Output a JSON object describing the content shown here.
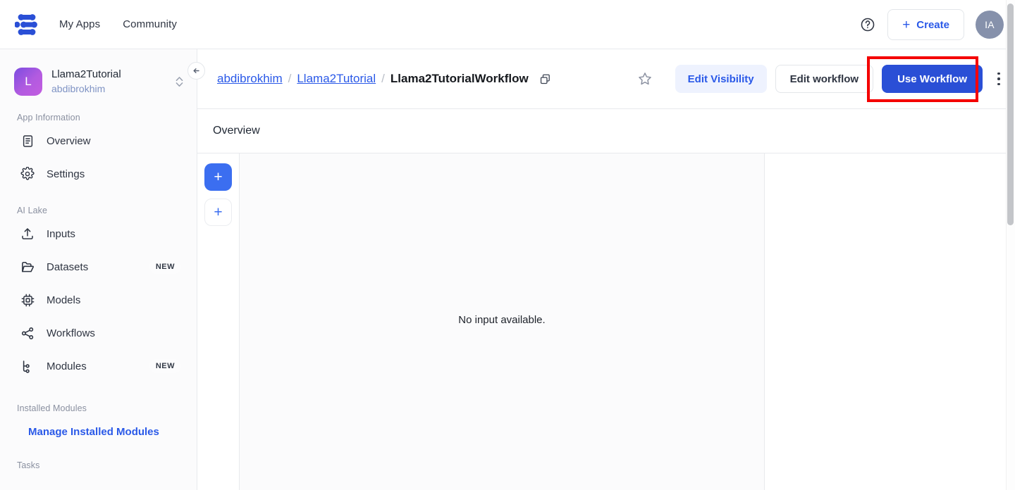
{
  "topnav": {
    "logo_name": "clarifai-logo",
    "links": [
      {
        "label": "My Apps",
        "name": "nav-my-apps"
      },
      {
        "label": "Community",
        "name": "nav-community"
      }
    ],
    "help_icon": "help-circle-icon",
    "create_label": "Create",
    "create_plus": "+",
    "avatar_initials": "IA"
  },
  "sidebar": {
    "app_avatar_letter": "L",
    "app_name": "Llama2Tutorial",
    "app_owner": "abdibrokhim",
    "switcher_icon": "chevron-up-down-icon",
    "section_app_information": "App Information",
    "section_ai_lake": "AI Lake",
    "section_installed_modules": "Installed Modules",
    "section_tasks": "Tasks",
    "manage_modules_label": "Manage Installed Modules",
    "app_items": [
      {
        "label": "Overview",
        "icon": "document-icon"
      },
      {
        "label": "Settings",
        "icon": "gear-icon"
      }
    ],
    "lake_items": [
      {
        "label": "Inputs",
        "icon": "upload-icon",
        "badge": ""
      },
      {
        "label": "Datasets",
        "icon": "folder-icon",
        "badge": "NEW"
      },
      {
        "label": "Models",
        "icon": "chip-icon",
        "badge": ""
      },
      {
        "label": "Workflows",
        "icon": "share-nodes-icon",
        "badge": ""
      },
      {
        "label": "Modules",
        "icon": "branch-icon",
        "badge": "NEW"
      }
    ]
  },
  "collapse_button": {
    "icon": "arrow-left-icon"
  },
  "breadcrumb": {
    "owner": "abdibrokhim",
    "sep": "/",
    "app": "Llama2Tutorial",
    "current": "Llama2TutorialWorkflow",
    "copy_icon": "copy-icon",
    "star_icon": "star-outline-icon"
  },
  "actions": {
    "edit_visibility": "Edit Visibility",
    "edit_workflow": "Edit workflow",
    "use_workflow": "Use Workflow",
    "kebab_icon": "more-vertical-icon",
    "highlight_color": "#f40000"
  },
  "overview": {
    "title": "Overview"
  },
  "workspace": {
    "add_button_primary": "+",
    "add_button_secondary": "+",
    "empty_message": "No input available."
  },
  "colors": {
    "accent_blue": "#2a59e8",
    "primary_button": "#2a4fd6",
    "soft_blue_bg": "#eef2fe",
    "canvas_bg": "#fbfbfc",
    "avatar_gray": "#8691ab"
  }
}
